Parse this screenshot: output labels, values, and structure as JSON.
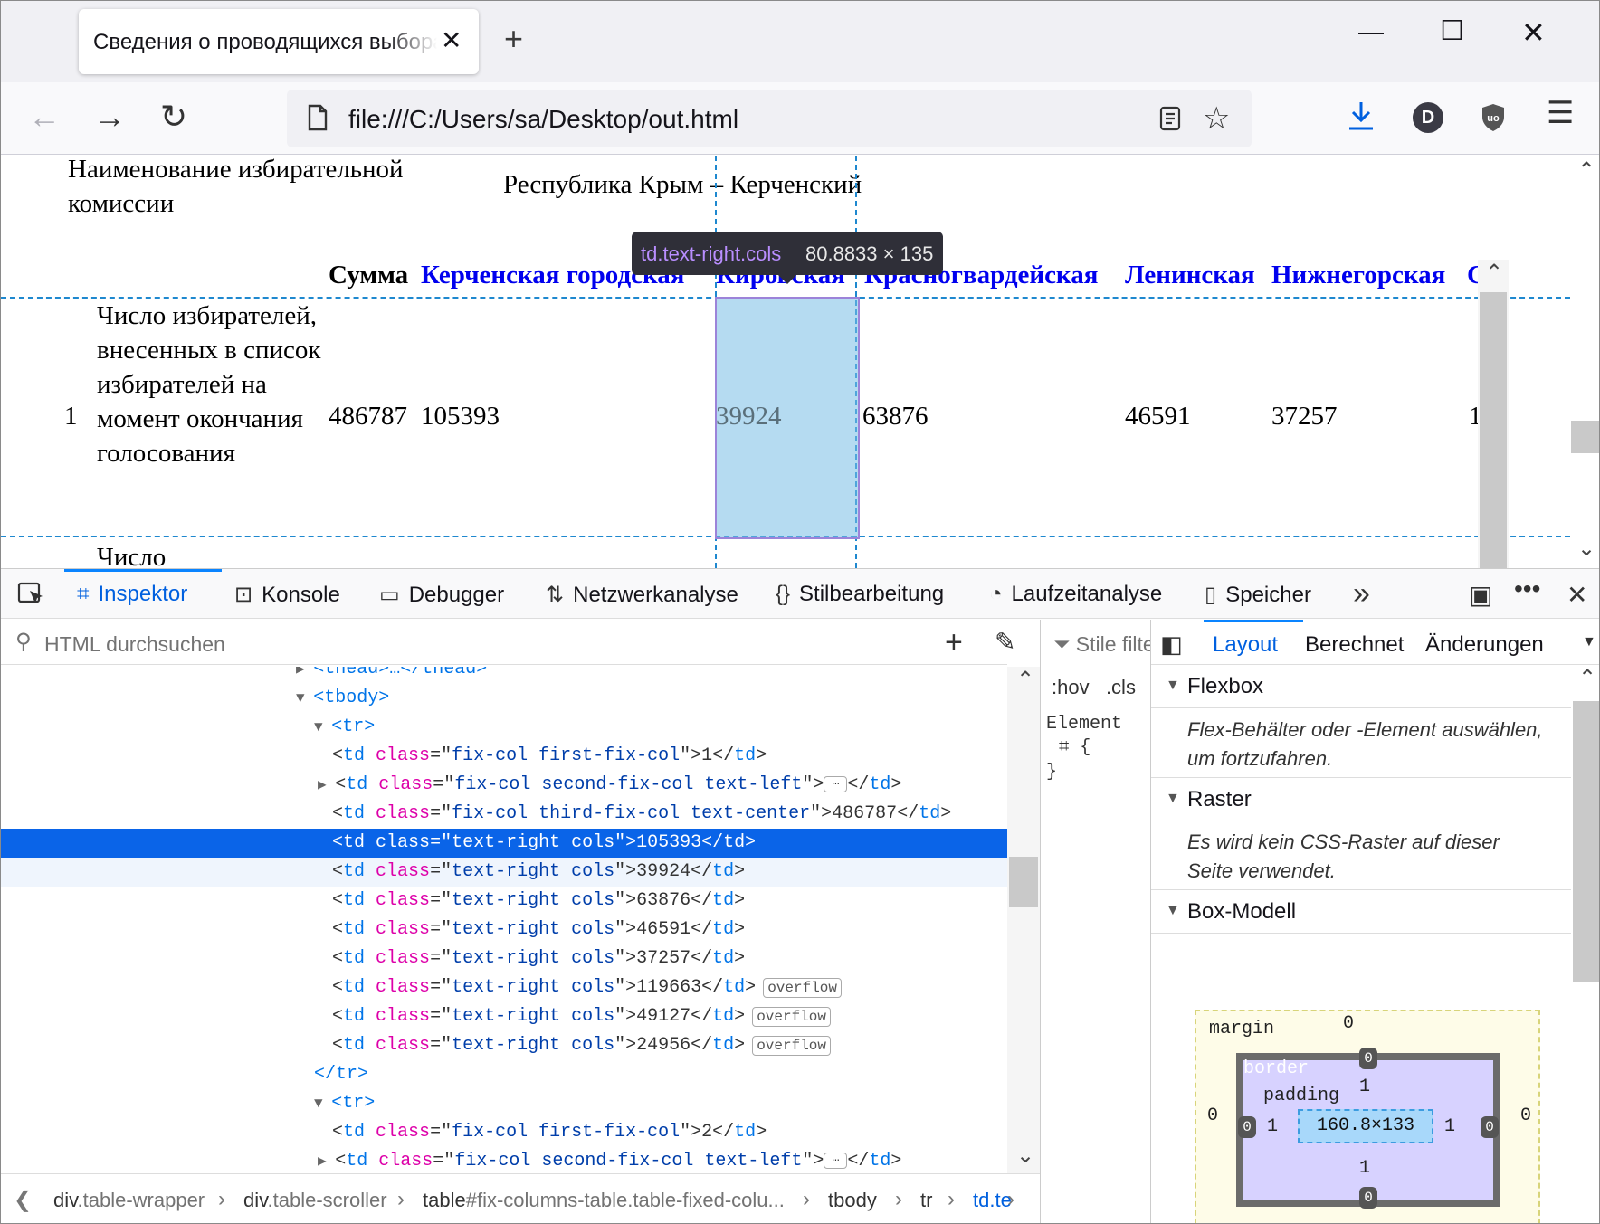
{
  "browser": {
    "tab_title": "Сведения о проводящихся выборах",
    "tab_close": "✕",
    "new_tab": "+",
    "url": "file:///C:/Users/sa/Desktop/out.html",
    "avatar_letter": "D"
  },
  "page": {
    "commission_label": "Наименование избирательной комиссии",
    "commission_value": "Республика Крым – Керченский",
    "headers": [
      "Сумма",
      "Керченская городская",
      "Кировская",
      "Красногвардейская",
      "Ленинская",
      "Нижнегорская",
      "С"
    ],
    "row1": {
      "num": "1",
      "label": "Число избирателей, внесенных в список избирателей на момент окончания голосования",
      "values": [
        "486787",
        "105393",
        "39924",
        "63876",
        "46591",
        "37257",
        "1"
      ]
    },
    "row2_label": "Число"
  },
  "tooltip": {
    "selector": "td.text-right.cols",
    "dimensions": "80.8833 × 135"
  },
  "devtools": {
    "tabs": [
      "Inspektor",
      "Konsole",
      "Debugger",
      "Netzwerkanalyse",
      "Stilbearbeitung",
      "Laufzeitanalyse",
      "Speicher"
    ],
    "search_placeholder": "HTML durchsuchen",
    "tree": [
      {
        "indent": 0,
        "text": "<thead>…</thead>"
      },
      {
        "indent": 0,
        "text": "<tbody>"
      },
      {
        "indent": 1,
        "text": "<tr>"
      },
      {
        "cls": "fix-col first-fix-col",
        "val": "1"
      },
      {
        "cls": "fix-col second-fix-col text-left",
        "val": "…"
      },
      {
        "cls": "fix-col third-fix-col text-center",
        "val": "486787"
      },
      {
        "cls": "text-right cols",
        "val": "105393"
      },
      {
        "cls": "text-right cols",
        "val": "39924"
      },
      {
        "cls": "text-right cols",
        "val": "63876"
      },
      {
        "cls": "text-right cols",
        "val": "46591"
      },
      {
        "cls": "text-right cols",
        "val": "37257"
      },
      {
        "cls": "text-right cols",
        "val": "119663",
        "badge": "overflow"
      },
      {
        "cls": "text-right cols",
        "val": "49127",
        "badge": "overflow"
      },
      {
        "cls": "text-right cols",
        "val": "24956",
        "badge": "overflow"
      },
      {
        "indent": 1,
        "text": "</tr>"
      },
      {
        "indent": 1,
        "text": "<tr>"
      },
      {
        "cls": "fix-col first-fix-col",
        "val": "2"
      },
      {
        "cls": "fix-col second-fix-col text-left",
        "val": "…"
      }
    ],
    "breadcrumbs": [
      {
        "tag": "div",
        "cls": ".table-wrapper"
      },
      {
        "tag": "div",
        "cls": ".table-scroller"
      },
      {
        "tag": "table",
        "cls": "#fix-columns-table.table-fixed-colu..."
      },
      {
        "tag": "tbody",
        "cls": ""
      },
      {
        "tag": "tr",
        "cls": ""
      },
      {
        "tag": "td",
        "cls": ".te"
      }
    ],
    "rules": {
      "filter": "Stile filtern",
      "hov": ":hov",
      "cls": ".cls",
      "element": "Element",
      "open": "{",
      "close": "}"
    },
    "layout_tabs": [
      "Layout",
      "Berechnet",
      "Änderungen"
    ],
    "sections": {
      "flexbox": {
        "title": "Flexbox",
        "note": "Flex-Behälter oder -Element auswählen, um fortzufahren."
      },
      "grid": {
        "title": "Raster",
        "note": "Es wird kein CSS-Raster auf dieser Seite verwendet."
      },
      "boxmodel": {
        "title": "Box-Modell"
      }
    },
    "box_model": {
      "margin_label": "margin",
      "border_label": "border",
      "padding_label": "padding",
      "content": "160.8×133",
      "margin": {
        "top": "0",
        "left": "0",
        "right": "0"
      },
      "border": {
        "top": "0",
        "left": "0",
        "right": "0",
        "bottom": "0"
      },
      "padding": {
        "top": "1",
        "left": "1",
        "right": "1",
        "bottom": "1"
      }
    }
  }
}
